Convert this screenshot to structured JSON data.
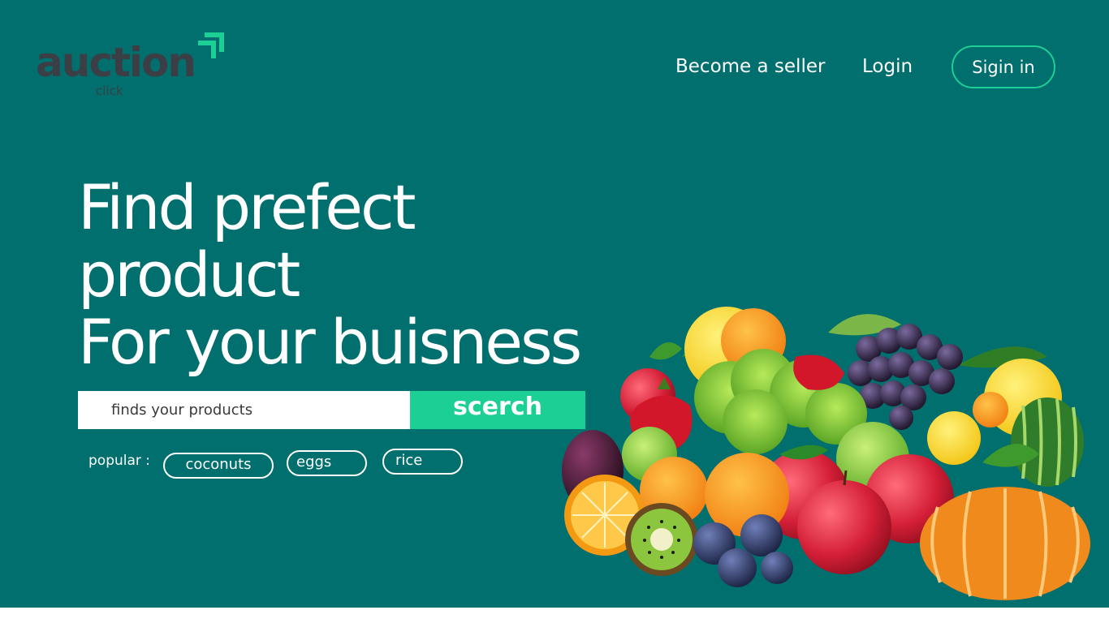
{
  "logo": {
    "word": "auction",
    "sub": "click",
    "icon": "double-arrow-up-right-icon"
  },
  "nav": {
    "become_seller": "Become a seller",
    "login": "Login",
    "signin": "Sigin in"
  },
  "hero": {
    "headline_lines": [
      "Find prefect",
      "product",
      "For your buisness"
    ]
  },
  "search": {
    "placeholder": "finds your products",
    "button_label": "scerch"
  },
  "popular": {
    "label": "popular :",
    "tags": [
      "coconuts",
      "eggs",
      "rice"
    ]
  },
  "illustration": {
    "subject": "fruit-vegetable-pile"
  },
  "colors": {
    "background": "#006f6e",
    "accent": "#1ccf94",
    "logo_dark": "#3b3f45",
    "text": "#ffffff"
  }
}
